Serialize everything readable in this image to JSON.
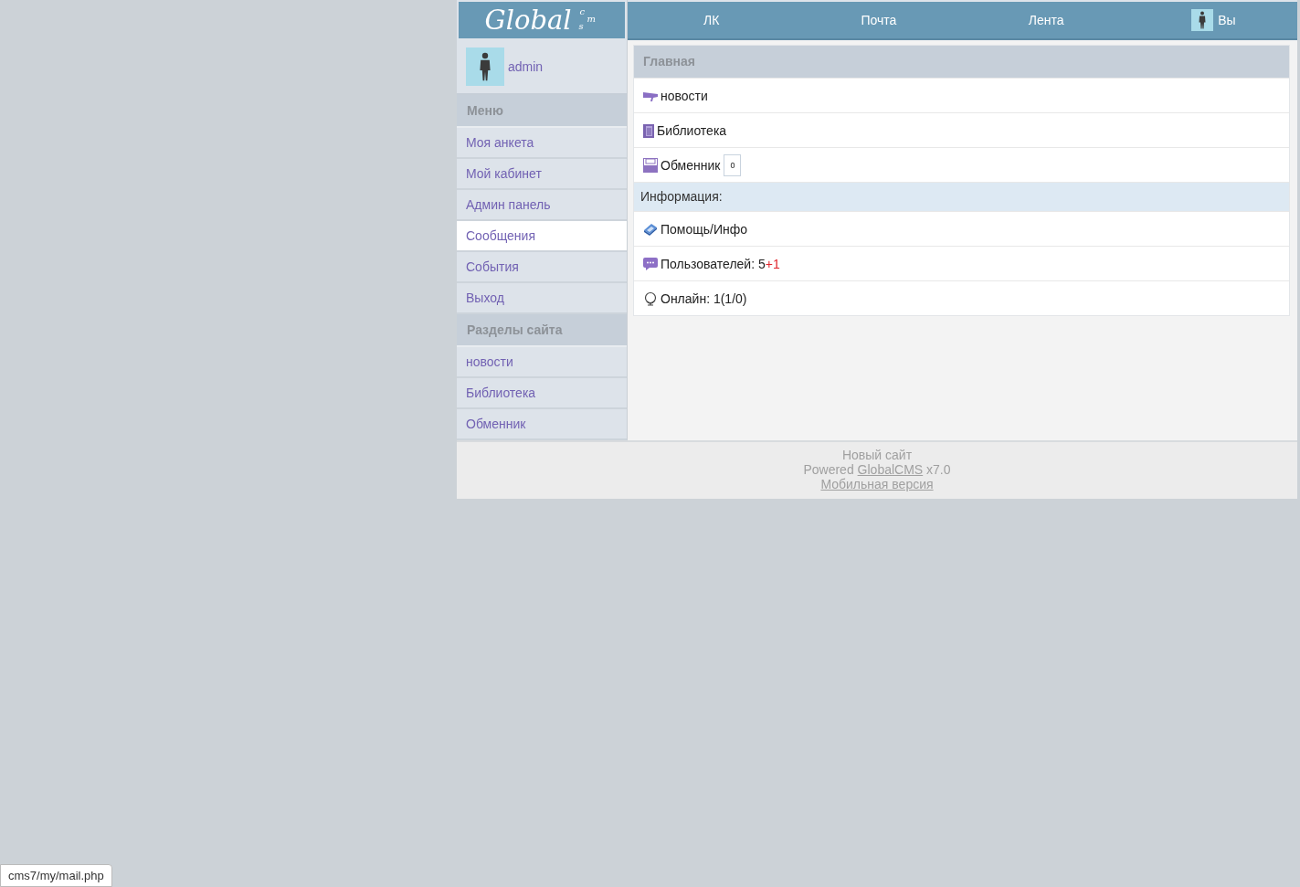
{
  "logo": {
    "word": "Global",
    "mark": [
      "c",
      "m",
      "s"
    ]
  },
  "nav": [
    {
      "kind": "link",
      "label": "ЛК"
    },
    {
      "kind": "link",
      "label": "Почта"
    },
    {
      "kind": "link",
      "label": "Лента"
    },
    {
      "kind": "profile",
      "label": "Вы"
    }
  ],
  "user": {
    "name": "admin"
  },
  "sidebar": [
    {
      "title": "Меню",
      "items": [
        {
          "label": "Моя анкета",
          "selected": false
        },
        {
          "label": "Мой кабинет",
          "selected": false
        },
        {
          "label": "Админ панель",
          "selected": false
        },
        {
          "label": "Сообщения",
          "selected": true
        },
        {
          "label": "События",
          "selected": false
        },
        {
          "label": "Выход",
          "selected": false
        }
      ]
    },
    {
      "title": "Разделы сайта",
      "items": [
        {
          "label": "новости",
          "selected": false
        },
        {
          "label": "Библиотека",
          "selected": false
        },
        {
          "label": "Обменник",
          "selected": false
        }
      ]
    }
  ],
  "main": {
    "title": "Главная",
    "rows": [
      {
        "kind": "link",
        "label": "новости"
      },
      {
        "kind": "link",
        "label": "Библиотека"
      },
      {
        "kind": "link",
        "label": "Обменник",
        "count": "0"
      },
      {
        "kind": "section",
        "label": "Информация:"
      },
      {
        "kind": "link",
        "label": "Помощь/Инфо"
      },
      {
        "kind": "link",
        "label": "Пользователей: 5",
        "highlight": "+1"
      },
      {
        "kind": "text",
        "label": "Онлайн: 1(1/0)"
      }
    ]
  },
  "footer": {
    "site": "Новый сайт",
    "powered_prefix": "Powered",
    "powered_link": "GlobalCMS",
    "powered_suffix": "x7.0",
    "mobile_link": "Мобильная версия"
  },
  "status_bar": {
    "url": "cms7/my/mail.php"
  }
}
